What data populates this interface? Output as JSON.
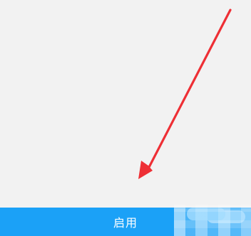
{
  "action_button": {
    "label": "启用"
  },
  "annotation": {
    "arrow_icon": "red-pointer-arrow-icon",
    "arrow_color": "#ee2f35"
  },
  "colors": {
    "background": "#f2f2f2",
    "button_background": "#1ba1f7",
    "button_text": "#ffffff"
  }
}
